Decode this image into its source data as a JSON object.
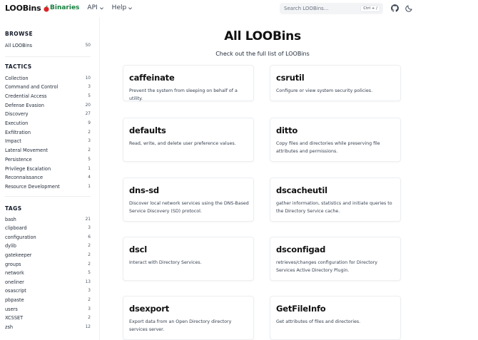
{
  "header": {
    "logo_text": "LOOBins",
    "nav": {
      "binaries": "Binaries",
      "api": "API",
      "help": "Help"
    },
    "search_placeholder": "Search LOOBins...",
    "search_shortcut": "Ctrl + /",
    "brand_color": "#15803d",
    "icons": [
      "apple-icon",
      "github-icon",
      "moon-icon"
    ]
  },
  "sidebar": {
    "browse_title": "BROWSE",
    "browse": [
      {
        "label": "All LOOBins",
        "count": "50"
      }
    ],
    "tactics_title": "TACTICS",
    "tactics": [
      {
        "label": "Collection",
        "count": "10"
      },
      {
        "label": "Command and Control",
        "count": "3"
      },
      {
        "label": "Credential Access",
        "count": "5"
      },
      {
        "label": "Defense Evasion",
        "count": "20"
      },
      {
        "label": "Discovery",
        "count": "27"
      },
      {
        "label": "Execution",
        "count": "9"
      },
      {
        "label": "Exfiltration",
        "count": "2"
      },
      {
        "label": "Impact",
        "count": "3"
      },
      {
        "label": "Lateral Movement",
        "count": "2"
      },
      {
        "label": "Persistence",
        "count": "5"
      },
      {
        "label": "Privilege Escalation",
        "count": "1"
      },
      {
        "label": "Reconnaissance",
        "count": "4"
      },
      {
        "label": "Resource Development",
        "count": "1"
      }
    ],
    "tags_title": "TAGS",
    "tags": [
      {
        "label": "bash",
        "count": "21"
      },
      {
        "label": "clipboard",
        "count": "3"
      },
      {
        "label": "configuration",
        "count": "6"
      },
      {
        "label": "dylib",
        "count": "2"
      },
      {
        "label": "gatekeeper",
        "count": "2"
      },
      {
        "label": "groups",
        "count": "2"
      },
      {
        "label": "network",
        "count": "5"
      },
      {
        "label": "oneliner",
        "count": "13"
      },
      {
        "label": "osascript",
        "count": "3"
      },
      {
        "label": "pbpaste",
        "count": "2"
      },
      {
        "label": "users",
        "count": "3"
      },
      {
        "label": "XCSSET",
        "count": "2"
      },
      {
        "label": "zsh",
        "count": "12"
      }
    ]
  },
  "main": {
    "title": "All LOOBins",
    "subtitle": "Check out the full list of LOOBins",
    "cards": [
      {
        "title": "caffeinate",
        "desc": "Prevent the system from sleeping on behalf of a utility."
      },
      {
        "title": "csrutil",
        "desc": "Configure or view system security policies."
      },
      {
        "title": "defaults",
        "desc": "Read, write, and delete user preference values."
      },
      {
        "title": "ditto",
        "desc": "Copy files and directories while preserving file attributes and permissions."
      },
      {
        "title": "dns-sd",
        "desc": "Discover local network services using the DNS-Based Service Discovery (SD) protocol."
      },
      {
        "title": "dscacheutil",
        "desc": "gather information, statistics and initiate queries to the Directory Service cache."
      },
      {
        "title": "dscl",
        "desc": "Interact with Directory Services."
      },
      {
        "title": "dsconfigad",
        "desc": "retrieves/changes configuration for Directory Services Active Directory Plugin."
      },
      {
        "title": "dsexport",
        "desc": "Export data from an Open Directory directory services server."
      },
      {
        "title": "GetFileInfo",
        "desc": "Get attributes of files and directories."
      }
    ]
  }
}
